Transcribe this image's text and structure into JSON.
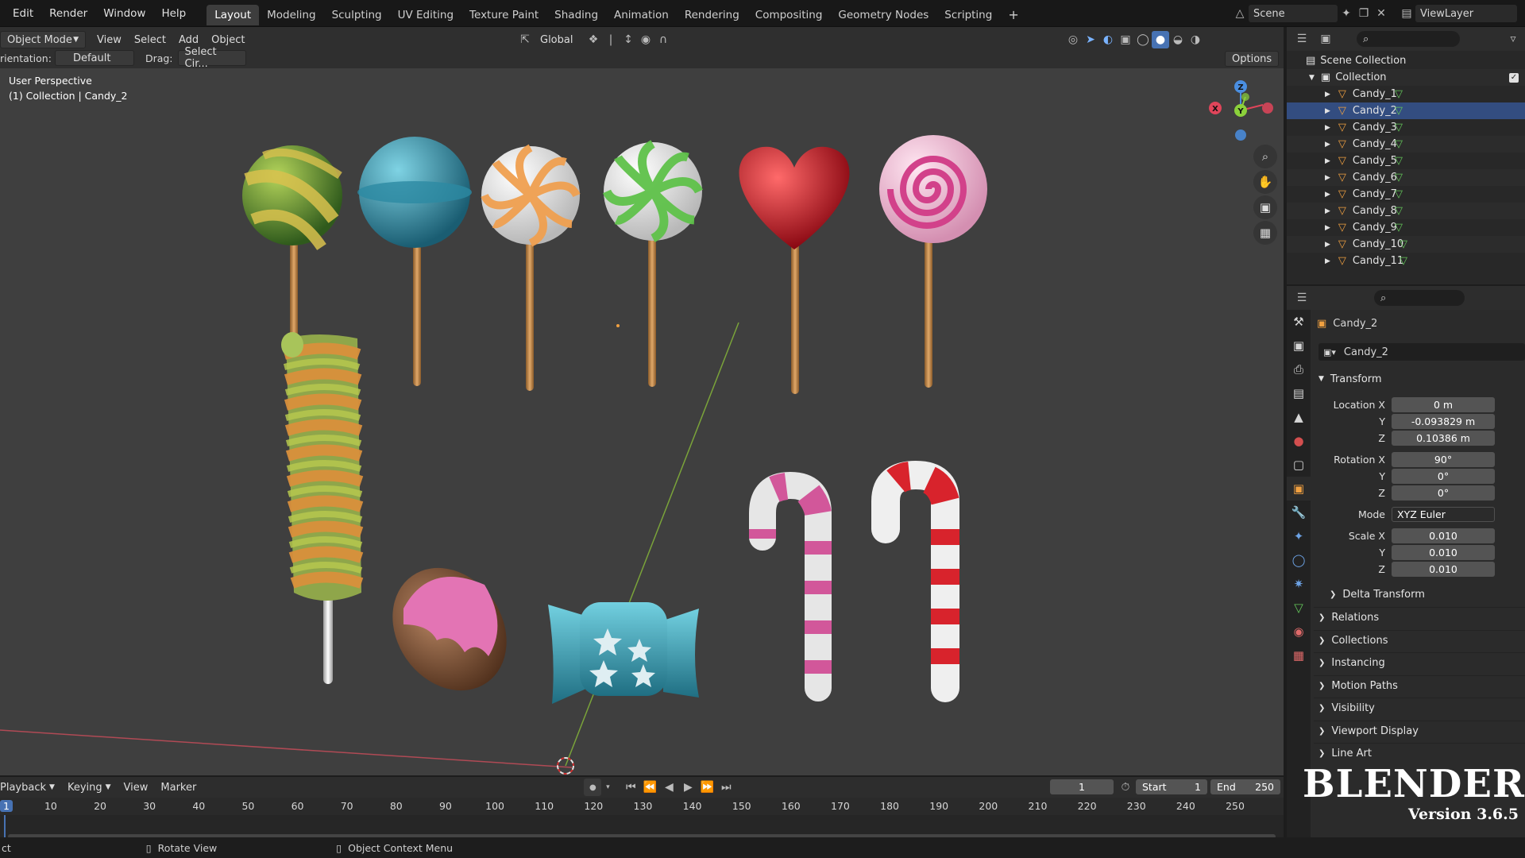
{
  "topbar": {
    "menus": [
      "Edit",
      "Render",
      "Window",
      "Help"
    ],
    "workspaces": [
      "Layout",
      "Modeling",
      "Sculpting",
      "UV Editing",
      "Texture Paint",
      "Shading",
      "Animation",
      "Rendering",
      "Compositing",
      "Geometry Nodes",
      "Scripting"
    ],
    "add_tab": "+",
    "scene": "Scene",
    "view_layer": "ViewLayer"
  },
  "viewport_header": {
    "mode": "Object Mode",
    "menus": [
      "View",
      "Select",
      "Add",
      "Object"
    ],
    "transform_orientation": "Global",
    "orientation_label": "rientation:",
    "orientation_value": "Default",
    "drag_label": "Drag:",
    "drag_value": "Select Cir...",
    "options": "Options"
  },
  "viewport": {
    "perspective": "User Perspective",
    "collection_info": "(1) Collection | Candy_2",
    "gizmo": {
      "z": "Z",
      "y": "Y",
      "x": "X"
    }
  },
  "outliner": {
    "scene_collection": "Scene Collection",
    "collection": "Collection",
    "items": [
      "Candy_1",
      "Candy_2",
      "Candy_3",
      "Candy_4",
      "Candy_5",
      "Candy_6",
      "Candy_7",
      "Candy_8",
      "Candy_9",
      "Candy_10",
      "Candy_11"
    ],
    "selected": "Candy_2"
  },
  "properties": {
    "object_name": "Candy_2",
    "datablock": "Candy_2",
    "transform_title": "Transform",
    "location_label": "Location X",
    "loc": {
      "x": "0 m",
      "y": "-0.093829 m",
      "z": "0.10386 m"
    },
    "rotation_label": "Rotation X",
    "rot": {
      "x": "90°",
      "y": "0°",
      "z": "0°"
    },
    "mode_label": "Mode",
    "mode": "XYZ Euler",
    "scale_label": "Scale X",
    "scale": {
      "x": "0.010",
      "y": "0.010",
      "z": "0.010"
    },
    "axis_y": "Y",
    "axis_z": "Z",
    "delta": "Delta Transform",
    "panels": [
      "Relations",
      "Collections",
      "Instancing",
      "Motion Paths",
      "Visibility",
      "Viewport Display",
      "Line Art"
    ]
  },
  "timeline": {
    "menus": [
      "Playback",
      "Keying",
      "View",
      "Marker"
    ],
    "current_frame": "1",
    "start_label": "Start",
    "start": "1",
    "end_label": "End",
    "end": "250",
    "ticks": [
      "1",
      "10",
      "20",
      "30",
      "40",
      "50",
      "60",
      "70",
      "80",
      "90",
      "100",
      "110",
      "120",
      "130",
      "140",
      "150",
      "160",
      "170",
      "180",
      "190",
      "200",
      "210",
      "220",
      "230",
      "240",
      "250"
    ]
  },
  "statusbar": {
    "left": "ct",
    "rotate": "Rotate View",
    "context": "Object Context Menu"
  },
  "watermark": {
    "title": "BLENDER",
    "version": "Version 3.6.5"
  },
  "colors": {
    "accent": "#4772b3",
    "selected_row": "#334d80",
    "x_axis": "#e0455a",
    "y_axis": "#8bd13b",
    "z_axis": "#4a8ee0"
  }
}
